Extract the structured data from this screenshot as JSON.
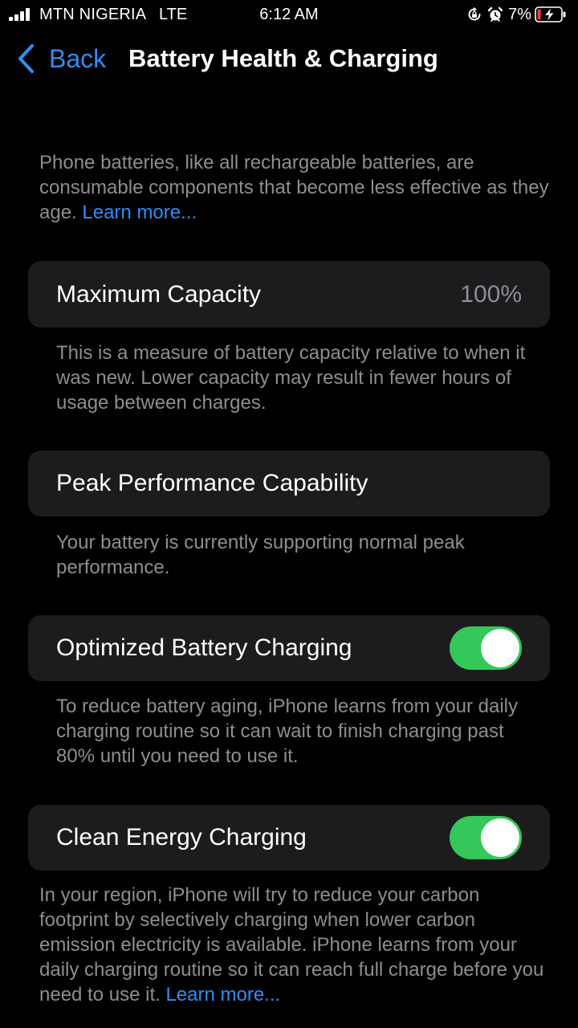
{
  "status_bar": {
    "carrier": "MTN NIGERIA",
    "network": "LTE",
    "time": "6:12 AM",
    "battery_percent": "7%",
    "icons": [
      "signal-bars-icon",
      "orientation-lock-icon",
      "alarm-clock-icon",
      "battery-charging-icon"
    ]
  },
  "nav": {
    "back_label": "Back",
    "title": "Battery Health & Charging"
  },
  "intro": {
    "text": "Phone batteries, like all rechargeable batteries, are consumable components that become less effective as they age.",
    "link": "Learn more..."
  },
  "max_capacity": {
    "label": "Maximum Capacity",
    "value": "100%",
    "description": "This is a measure of battery capacity relative to when it was new. Lower capacity may result in fewer hours of usage between charges."
  },
  "peak_performance": {
    "label": "Peak Performance Capability",
    "description": "Your battery is currently supporting normal peak performance."
  },
  "optimized_charging": {
    "label": "Optimized Battery Charging",
    "enabled": true,
    "description": "To reduce battery aging, iPhone learns from your daily charging routine so it can wait to finish charging past 80% until you need to use it."
  },
  "clean_energy": {
    "label": "Clean Energy Charging",
    "enabled": true,
    "description": "In your region, iPhone will try to reduce your carbon footprint by selectively charging when lower carbon emission electricity is available. iPhone learns from your daily charging routine so it can reach full charge before you need to use it.",
    "link": "Learn more..."
  },
  "colors": {
    "accent": "#2f8df6",
    "toggle_on": "#34c759",
    "battery_low": "#ff3b30",
    "card_bg": "#1c1c1e",
    "secondary_text": "#8d8d93"
  }
}
